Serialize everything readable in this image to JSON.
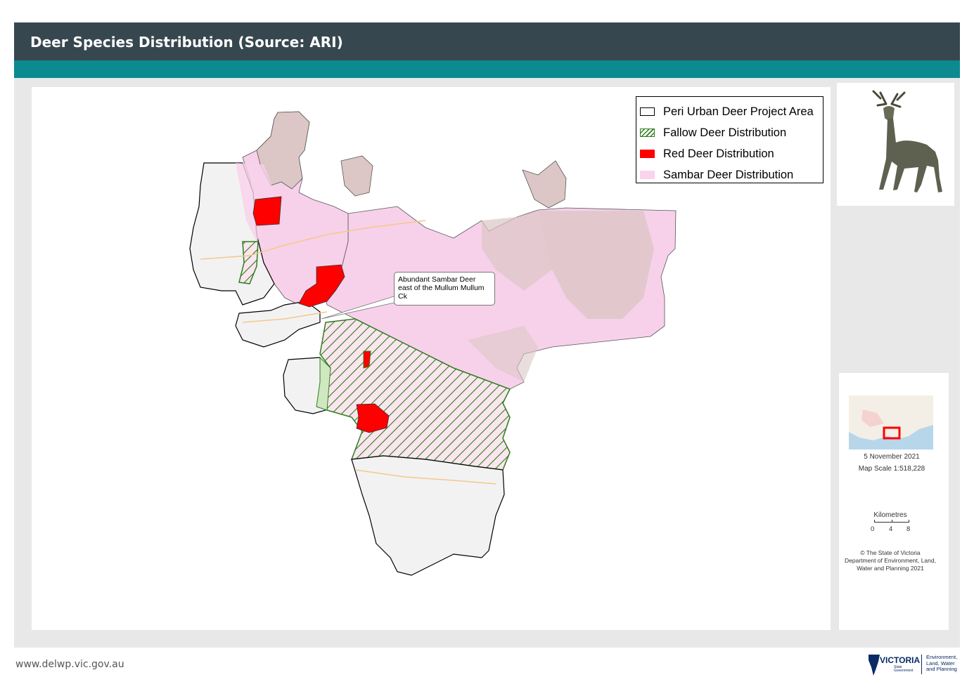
{
  "header": {
    "title": "Deer Species Distribution (Source: ARI)"
  },
  "legend": {
    "items": [
      {
        "label": "Peri Urban Deer Project Area",
        "swatch": "outline",
        "color": "#000000"
      },
      {
        "label": "Fallow Deer Distribution",
        "swatch": "hatch",
        "color": "#2e7d1e"
      },
      {
        "label": "Red Deer Distribution",
        "swatch": "solid",
        "color": "#ff0000"
      },
      {
        "label": "Sambar Deer Distribution",
        "swatch": "solid",
        "color": "#fbd3ec"
      }
    ]
  },
  "map": {
    "callout": "Abundant Sambar Deer east of the Mullum Mullum Ck",
    "colors": {
      "sambar": "#f7d1ea",
      "mauve": "#dcc6c6",
      "fallow": "#2e7d1e",
      "red": "#ff0000",
      "urban": "#f2f2f2"
    }
  },
  "info": {
    "date": "5 November 2021",
    "scale": "Map Scale  1:518,228",
    "km_label": "Kilometres",
    "km_ticks": [
      "0",
      "4",
      "8"
    ],
    "copyright": [
      "© The State of Victoria",
      "Department of Environment, Land,",
      "Water and Planning  2021"
    ]
  },
  "footer": {
    "url": "www.delwp.vic.gov.au",
    "logo": {
      "name": "VICTORIA",
      "sub": [
        "State",
        "Government"
      ],
      "dept": [
        "Environment,",
        "Land, Water",
        "and Planning"
      ]
    }
  },
  "icons": {
    "deer": "deer-icon",
    "logo": "victoria-logo-icon"
  }
}
